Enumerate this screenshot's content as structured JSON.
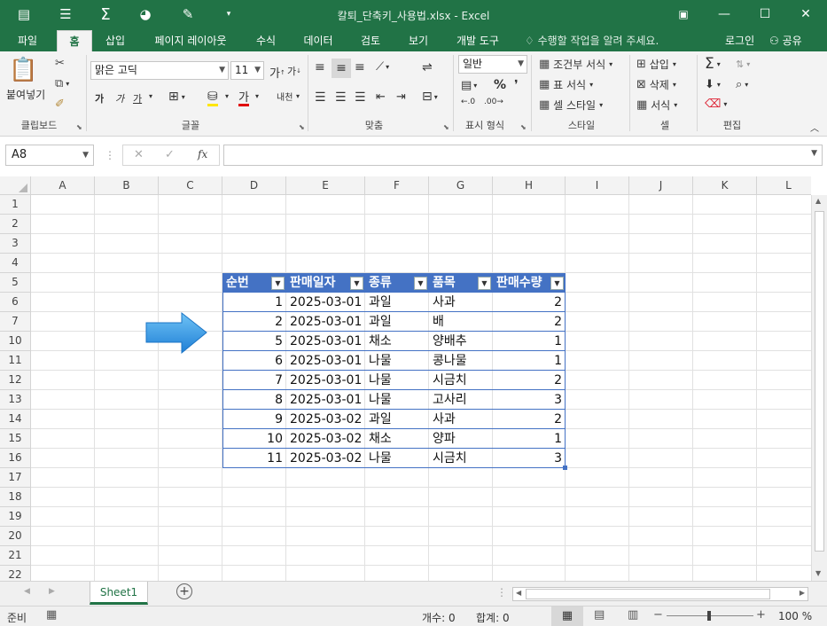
{
  "window": {
    "title": "칼퇴_단축키_사용법.xlsx - Excel"
  },
  "tabs": [
    "파일",
    "홈",
    "삽입",
    "페이지 레이아웃",
    "수식",
    "데이터",
    "검토",
    "보기",
    "개발 도구"
  ],
  "tell_me": "수행할 작업을 알려 주세요.",
  "login": "로그인",
  "share": "공유",
  "ribbon": {
    "clipboard": {
      "paste": "붙여넣기",
      "label": "클립보드"
    },
    "font": {
      "name": "맑은 고딕",
      "size": "11",
      "label": "글꼴",
      "bold": "가",
      "italic": "가",
      "underline": "가",
      "fontcolor": "가",
      "phonetic": "내천"
    },
    "align": {
      "label": "맞춤"
    },
    "number": {
      "format": "일반",
      "label": "표시 형식"
    },
    "styles": {
      "conditional": "조건부 서식",
      "table": "표 서식",
      "cell": "셀 스타일",
      "label": "스타일"
    },
    "cells": {
      "insert": "삽입",
      "delete": "삭제",
      "format": "서식",
      "label": "셀"
    },
    "editing": {
      "label": "편집"
    }
  },
  "formula": {
    "namebox": "A8",
    "fx": "fx",
    "content": ""
  },
  "columns": [
    "A",
    "B",
    "C",
    "D",
    "E",
    "F",
    "G",
    "H",
    "I",
    "J",
    "K",
    "L"
  ],
  "rows": [
    "1",
    "2",
    "3",
    "4",
    "5",
    "6",
    "7",
    "10",
    "11",
    "12",
    "13",
    "14",
    "15",
    "16",
    "17",
    "18",
    "19",
    "20",
    "21",
    "22"
  ],
  "table": {
    "headers": [
      "순번",
      "판매일자",
      "종류",
      "품목",
      "판매수량"
    ],
    "rows": [
      [
        "1",
        "2025-03-01",
        "과일",
        "사과",
        "2"
      ],
      [
        "2",
        "2025-03-01",
        "과일",
        "배",
        "2"
      ],
      [
        "5",
        "2025-03-01",
        "채소",
        "양배추",
        "1"
      ],
      [
        "6",
        "2025-03-01",
        "나물",
        "콩나물",
        "1"
      ],
      [
        "7",
        "2025-03-01",
        "나물",
        "시금치",
        "2"
      ],
      [
        "8",
        "2025-03-01",
        "나물",
        "고사리",
        "3"
      ],
      [
        "9",
        "2025-03-02",
        "과일",
        "사과",
        "2"
      ],
      [
        "10",
        "2025-03-02",
        "채소",
        "양파",
        "1"
      ],
      [
        "11",
        "2025-03-02",
        "나물",
        "시금치",
        "3"
      ]
    ]
  },
  "sheet": {
    "tab": "Sheet1"
  },
  "status": {
    "mode": "준비",
    "count": "개수: 0",
    "sum": "합계: 0",
    "zoom": "100 %"
  },
  "colors": {
    "excel_green": "#217346",
    "table_header": "#4472c4",
    "table_border": "#4472c4",
    "arrow": "#2e9be6"
  }
}
